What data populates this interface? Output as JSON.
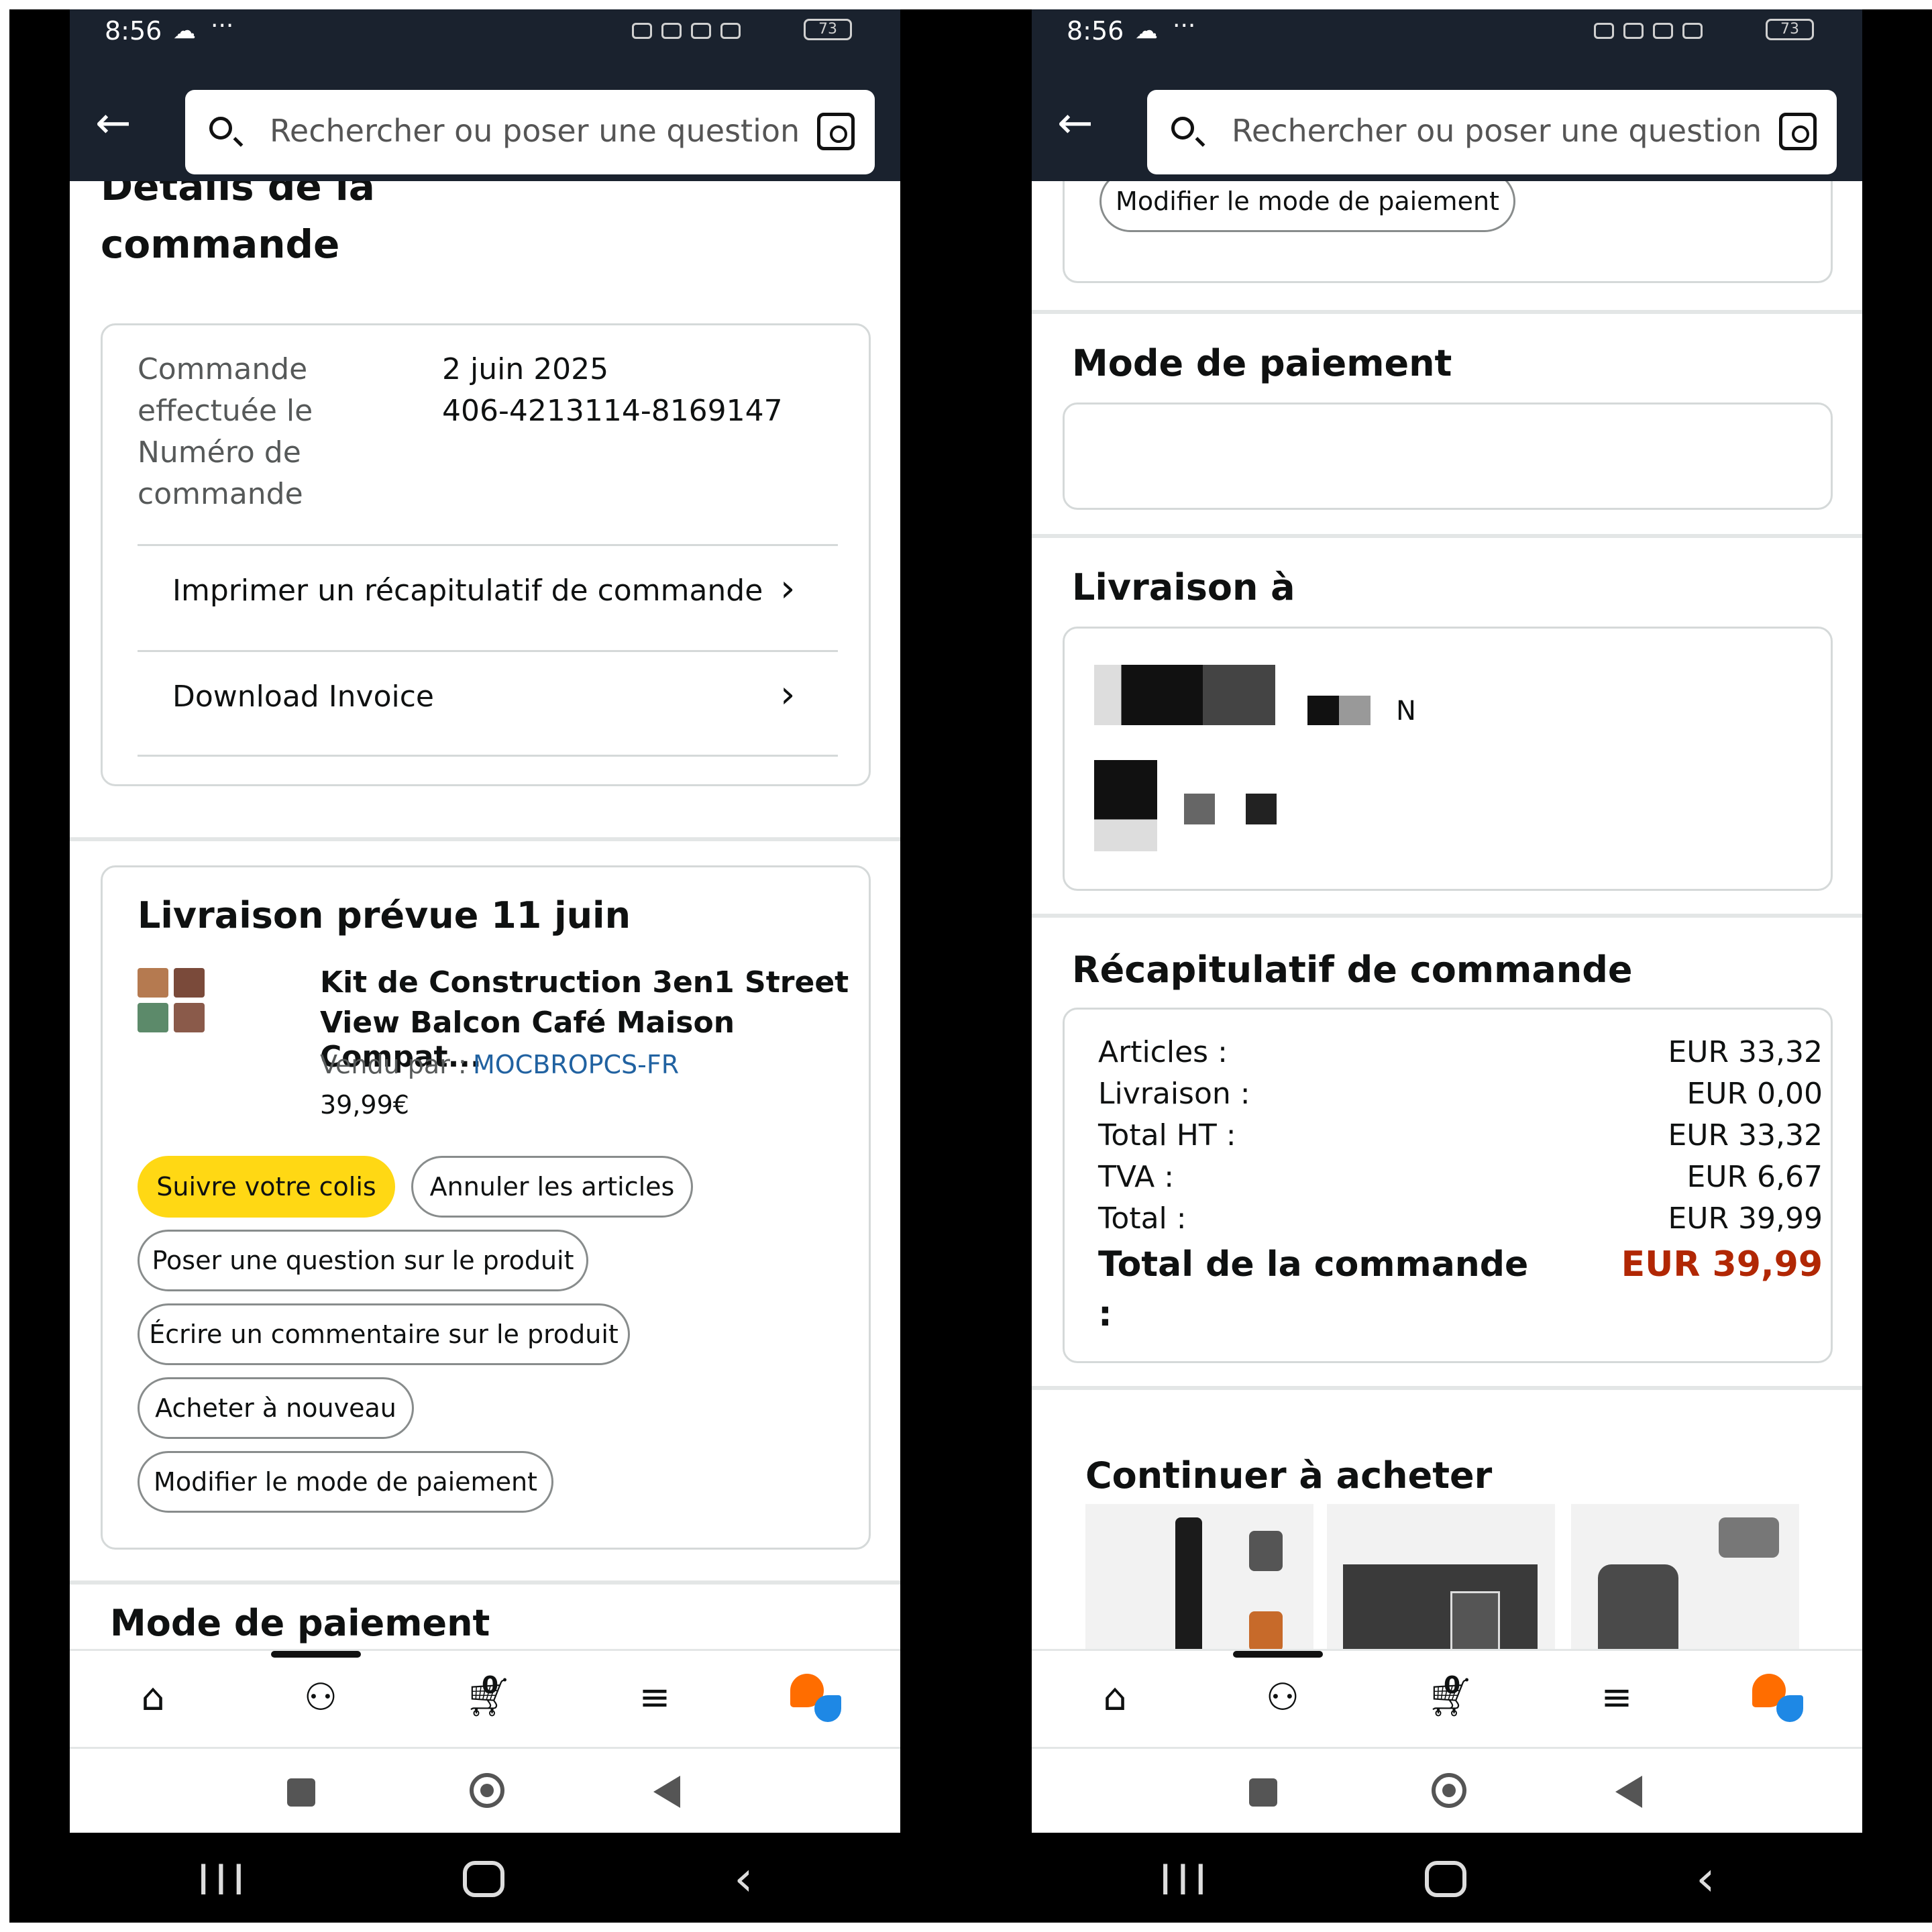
{
  "status": {
    "time": "8:56",
    "battery": "73"
  },
  "search": {
    "placeholder": "Rechercher ou poser une question"
  },
  "left": {
    "title_line1": "Détails de la",
    "title_line2": "commande",
    "order_info": {
      "label_date_1": "Commande",
      "label_date_2": "effectuée le",
      "label_num_1": "Numéro de",
      "label_num_2": "commande",
      "date": "2 juin 2025",
      "number": "406-4213114-8169147"
    },
    "links": [
      "Imprimer un récapitulatif de commande",
      "Download Invoice"
    ],
    "delivery_heading": "Livraison prévue 11 juin",
    "product": {
      "title_line1": "Kit de Construction 3en1 Street",
      "title_line2": "View Balcon Café Maison Compat...",
      "sold_by_label": "Vendu par  :",
      "seller": "MOCBROPCS-FR",
      "price": "39,99€"
    },
    "buttons": {
      "track": "Suivre votre colis",
      "cancel": "Annuler les articles",
      "ask": "Poser une question sur le produit",
      "review": "Écrire un commentaire sur le produit",
      "buy_again": "Acheter à nouveau",
      "change_payment": "Modifier le mode de paiement"
    },
    "payment_heading": "Mode de paiement"
  },
  "right": {
    "change_payment": "Modifier le mode de paiement",
    "payment_heading": "Mode de paiement",
    "delivery_heading": "Livraison à",
    "address_fragment": "N",
    "summary_heading": "Récapitulatif de commande",
    "summary": [
      {
        "label": "Articles :",
        "value": "EUR 33,32"
      },
      {
        "label": "Livraison :",
        "value": "EUR 0,00"
      },
      {
        "label": "Total HT :",
        "value": "EUR 33,32"
      },
      {
        "label": "TVA :",
        "value": "EUR 6,67"
      },
      {
        "label": "Total :",
        "value": "EUR 39,99"
      }
    ],
    "grand_total_label_1": "Total de la commande",
    "grand_total_label_2": ":",
    "grand_total_value": "EUR 39,99",
    "continue_heading": "Continuer à acheter"
  },
  "nav": {
    "cart_count": "0",
    "icons": [
      "home-icon",
      "account-icon",
      "cart-icon",
      "menu-icon",
      "rufus-icon"
    ]
  },
  "colors": {
    "header_bg": "#1a222e",
    "track_button": "#ffd814",
    "seller_link": "#2162a1",
    "grand_total": "#b12704"
  }
}
